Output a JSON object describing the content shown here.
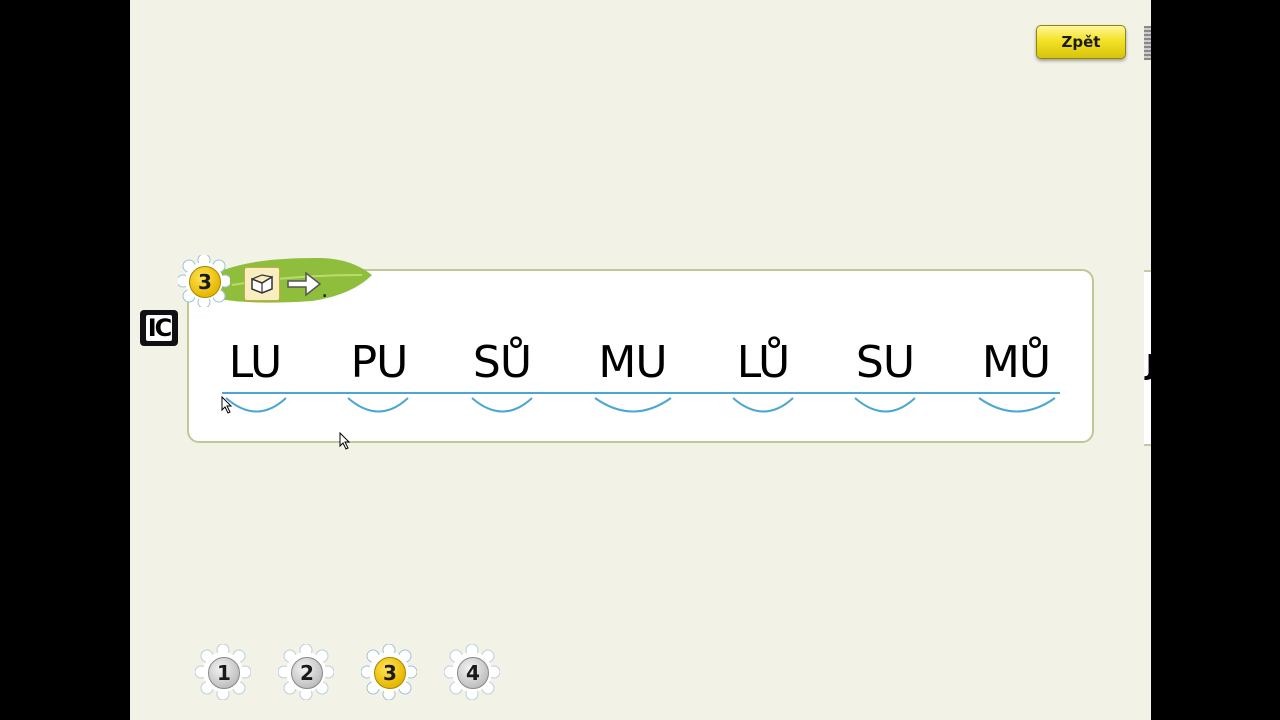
{
  "header": {
    "back_label": "Zpět"
  },
  "exercise": {
    "task_number": "3",
    "period": ".",
    "instruction_icons": [
      "book-icon",
      "arrow-right-icon"
    ],
    "side_icon": "IC",
    "syllables": [
      "LU",
      "PU",
      "SŮ",
      "MU",
      "LŮ",
      "SU",
      "MŮ"
    ],
    "colors": {
      "accent_green": "#8fbe3c",
      "line_blue": "#49a7d1",
      "badge_yellow": "#f3d11c"
    }
  },
  "pager": {
    "pages": [
      "1",
      "2",
      "3",
      "4"
    ],
    "active_page": "3"
  }
}
